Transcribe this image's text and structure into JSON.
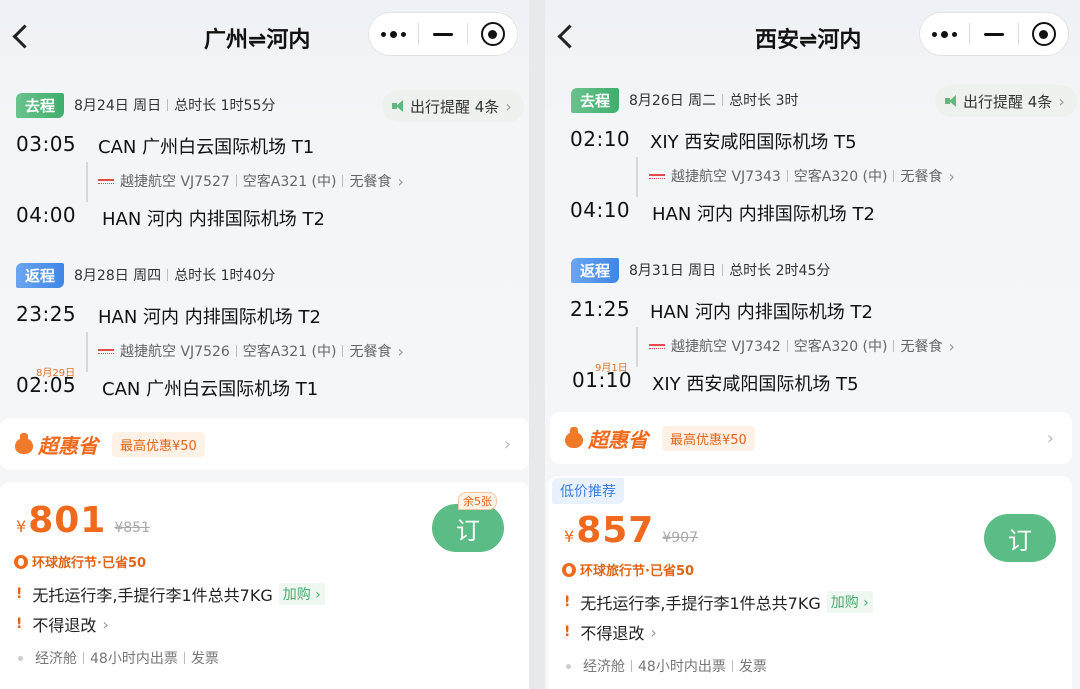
{
  "left": {
    "title": "广州⇌河内",
    "outbound": {
      "tag": "去程",
      "date": "8月24日 周日",
      "duration": "总时长 1时55分",
      "remind": "出行提醒 4条",
      "dep_time": "03:05",
      "dep_airport": "CAN 广州白云国际机场 T1",
      "carrier": "越捷航空 VJ7527",
      "aircraft": "空客A321 (中)",
      "meal": "无餐食",
      "arr_time": "04:00",
      "arr_airport": "HAN 河内 内排国际机场 T2"
    },
    "return": {
      "tag": "返程",
      "date": "8月28日 周四",
      "duration": "总时长 1时40分",
      "dep_time": "23:25",
      "dep_airport": "HAN 河内 内排国际机场 T2",
      "carrier": "越捷航空 VJ7526",
      "aircraft": "空客A321 (中)",
      "meal": "无餐食",
      "arr_date": "8月29日",
      "arr_time": "02:05",
      "arr_airport": "CAN 广州白云国际机场 T1"
    },
    "promo": {
      "name": "超惠省",
      "max": "最高优惠¥50"
    },
    "fare": {
      "yen": "¥",
      "price": "801",
      "old_price": "¥851",
      "seats": "余5张",
      "festival": "环球旅行节·已省50",
      "baggage": "无托运行李,手提行李1件总共7KG",
      "addon": "加购",
      "refund": "不得退改",
      "cabin": "经济舱",
      "ticketing": "48小时内出票",
      "invoice": "发票",
      "book": "订"
    }
  },
  "right": {
    "title": "西安⇌河内",
    "outbound": {
      "tag": "去程",
      "date": "8月26日 周二",
      "duration": "总时长 3时",
      "remind": "出行提醒 4条",
      "dep_time": "02:10",
      "dep_airport": "XIY 西安咸阳国际机场 T5",
      "carrier": "越捷航空 VJ7343",
      "aircraft": "空客A320 (中)",
      "meal": "无餐食",
      "arr_time": "04:10",
      "arr_airport": "HAN 河内 内排国际机场 T2"
    },
    "return": {
      "tag": "返程",
      "date": "8月31日 周日",
      "duration": "总时长 2时45分",
      "dep_time": "21:25",
      "dep_airport": "HAN 河内 内排国际机场 T2",
      "carrier": "越捷航空 VJ7342",
      "aircraft": "空客A320 (中)",
      "meal": "无餐食",
      "arr_date": "9月1日",
      "arr_time": "01:10",
      "arr_airport": "XIY 西安咸阳国际机场 T5"
    },
    "promo": {
      "name": "超惠省",
      "max": "最高优惠¥50"
    },
    "fare": {
      "low_tag": "低价推荐",
      "yen": "¥",
      "price": "857",
      "old_price": "¥907",
      "festival": "环球旅行节·已省50",
      "baggage": "无托运行李,手提行李1件总共7KG",
      "addon": "加购",
      "refund": "不得退改",
      "cabin": "经济舱",
      "ticketing": "48小时内出票",
      "invoice": "发票",
      "book": "订"
    }
  },
  "colors": {
    "accent_green": "#5cbc85",
    "price_orange": "#f06a1e",
    "return_blue": "#3f86e6"
  }
}
